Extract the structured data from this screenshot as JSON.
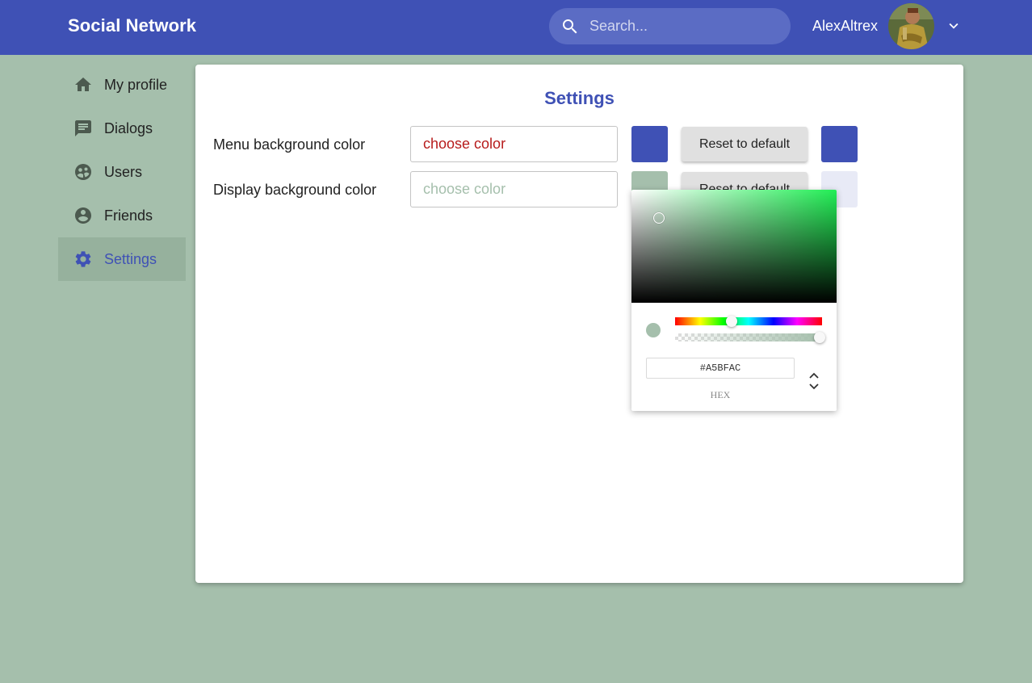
{
  "header": {
    "brand": "Social Network",
    "search_placeholder": "Search...",
    "username": "AlexAltrex",
    "bar_color": "#3f51b5"
  },
  "sidebar": {
    "items": [
      {
        "label": "My profile",
        "icon": "home-icon",
        "active": false
      },
      {
        "label": "Dialogs",
        "icon": "message-icon",
        "active": false
      },
      {
        "label": "Users",
        "icon": "users-icon",
        "active": false
      },
      {
        "label": "Friends",
        "icon": "account-circle-icon",
        "active": false
      },
      {
        "label": "Settings",
        "icon": "gear-icon",
        "active": true
      }
    ]
  },
  "settings": {
    "title": "Settings",
    "rows": [
      {
        "label": "Menu background color",
        "placeholder": "choose color",
        "swatch_color": "#3f51b5",
        "reset_label": "Reset to default",
        "default_color": "#3f51b5"
      },
      {
        "label": "Display background color",
        "placeholder": "choose color",
        "swatch_color": "#a5bfac",
        "reset_label": "Reset to default",
        "default_color": "#e8eaf6"
      }
    ]
  },
  "color_picker": {
    "hex_value": "#A5BFAC",
    "mode_label": "HEX",
    "hue_color": "#22ee55"
  },
  "page": {
    "background": "#a5bfac"
  }
}
